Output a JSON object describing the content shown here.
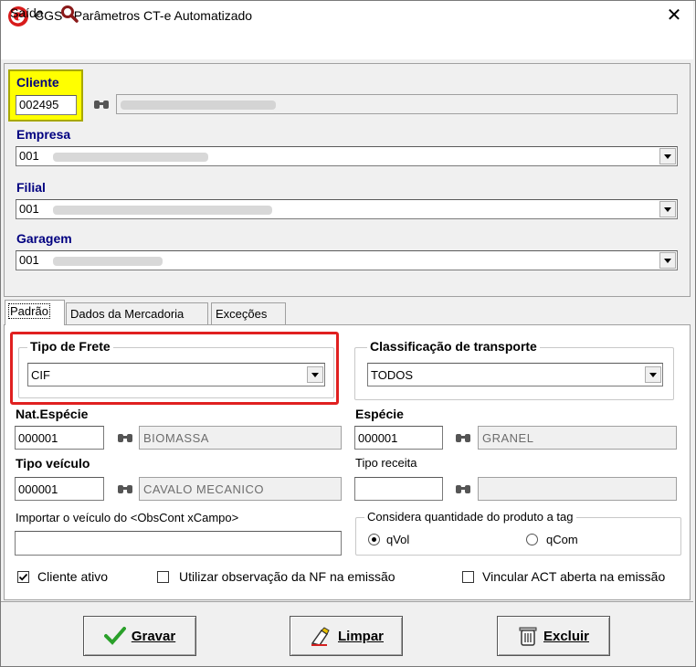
{
  "window": {
    "title": "CGS - Parâmetros CT-e Automatizado"
  },
  "menu": {
    "saida_label": "Saída"
  },
  "cliente": {
    "label": "Cliente",
    "code": "002495",
    "name": ""
  },
  "empresa": {
    "label": "Empresa",
    "value": "001"
  },
  "filial": {
    "label": "Filial",
    "value": "001"
  },
  "garagem": {
    "label": "Garagem",
    "value": "001"
  },
  "tabs": [
    {
      "label": "Padrão"
    },
    {
      "label": "Dados da Mercadoria"
    },
    {
      "label": "Exceções"
    }
  ],
  "tipo_frete": {
    "label": "Tipo de Frete",
    "value": "CIF"
  },
  "classificacao": {
    "label": "Classificação de transporte",
    "value": "TODOS"
  },
  "nat_especie": {
    "label": "Nat.Espécie",
    "code": "000001",
    "name": "BIOMASSA"
  },
  "especie": {
    "label": "Espécie",
    "code": "000001",
    "name": "GRANEL"
  },
  "tipo_veiculo": {
    "label": "Tipo veículo",
    "code": "000001",
    "name": "CAVALO MECANICO"
  },
  "tipo_receita": {
    "label": "Tipo receita",
    "code": "",
    "name": ""
  },
  "importar": {
    "label": "Importar o veículo do <ObsCont xCampo>",
    "value": ""
  },
  "considera": {
    "label": "Considera quantidade do produto a tag",
    "options": [
      "qVol",
      "qCom"
    ],
    "selected": "qVol"
  },
  "checks": {
    "cliente_ativo": {
      "label": "Cliente ativo",
      "checked": true
    },
    "utilizar_obs": {
      "label": "Utilizar observação da NF na emissão",
      "checked": false
    },
    "vincular_act": {
      "label": "Vincular ACT aberta na emissão",
      "checked": false
    }
  },
  "buttons": {
    "gravar": "Gravar",
    "limpar": "Limpar",
    "excluir": "Excluir"
  },
  "colors": {
    "highlight_yellow": "#ffff00",
    "annotation_red": "#e02020",
    "label_blue": "#000080"
  }
}
